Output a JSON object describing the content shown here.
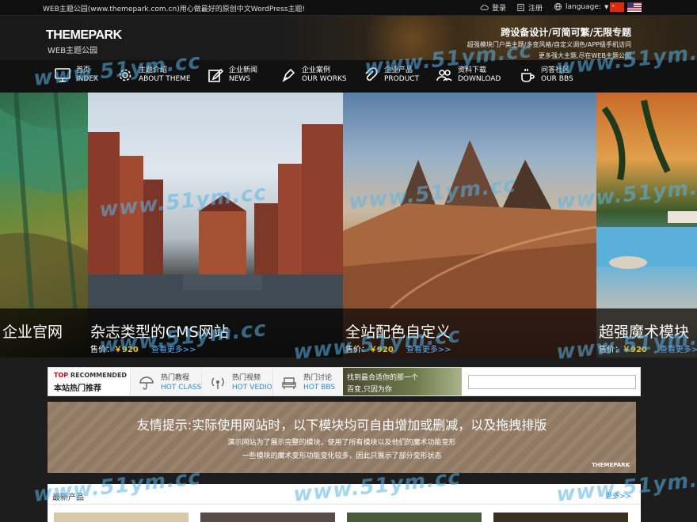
{
  "topbar": {
    "notice": "WEB主题公园(www.themepark.com.cn)用心做最好的原创中文WordPress主题!",
    "login": "登录",
    "register": "注册",
    "language": "language:"
  },
  "header": {
    "logo_main": "THEMEPARK",
    "logo_sub": "WEB主题公园",
    "slogan_1": "跨设备设计/可简可繁/无限专题",
    "slogan_2": "超强模块门户类主题/多变风格/自定义调色/APP级手机访问",
    "slogan_3": "更多强大主题,尽在WEB主题公园"
  },
  "nav": [
    {
      "cn": "首页",
      "en": "INDEX",
      "icon": "monitor-icon"
    },
    {
      "cn": "主题介绍",
      "en": "ABOUT THEME",
      "icon": "gear-icon"
    },
    {
      "cn": "企业新闻",
      "en": "NEWS",
      "icon": "pencil-icon"
    },
    {
      "cn": "企业案例",
      "en": "OUR WORKS",
      "icon": "pen-nib-icon"
    },
    {
      "cn": "企业产品",
      "en": "PRODUCT",
      "icon": "paperclip-icon"
    },
    {
      "cn": "资料下载",
      "en": "DOWNLOAD",
      "icon": "users-icon"
    },
    {
      "cn": "问答社区",
      "en": "OUR BBS",
      "icon": "coffee-icon"
    }
  ],
  "slides": [
    {
      "title": "企业官网",
      "price_label": "",
      "price": "",
      "more": ""
    },
    {
      "title": "杂志类型的CMS网站",
      "price_label": "售价：",
      "price": "￥920",
      "more": "查看更多>>"
    },
    {
      "title": "全站配色自定义",
      "price_label": "售价：",
      "price": "￥920",
      "more": "查看更多>>"
    },
    {
      "title": "超强魔术模块",
      "price_label": "售价：",
      "price": "￥920",
      "more": "查看更多>>"
    }
  ],
  "tabs": {
    "top_word": "TOP",
    "recommended_word": "RECOMMENDED",
    "recommended_cn": "本站热门推荐",
    "items": [
      {
        "cn": "热门教程",
        "en": "HOT CLASS",
        "icon": "umbrella-icon"
      },
      {
        "cn": "热门视频",
        "en": "HOT VEDIO",
        "icon": "broadcast-icon"
      },
      {
        "cn": "热门讨论",
        "en": "HOT BBS",
        "icon": "sofa-icon"
      }
    ],
    "ad_line1": "找到最合适你的那一个",
    "ad_line2": "百变,只因为你"
  },
  "banner": {
    "title": "友情提示:实际使用网站时，以下模块均可自由增加或删减，以及拖拽排版",
    "line1": "演示网站为了展示完整的模块，使用了所有模块以及他们的魔术功能变形",
    "line2": "一些模块的魔术变形功能变化较多，因此只展示了部分变形状态",
    "brand": "THEMEPARK"
  },
  "latest": {
    "title": "最新产品",
    "more": "更多>>"
  },
  "watermark": "www.51ym.cc",
  "colors": {
    "price": "#f2c21b",
    "link": "#5ab0ff",
    "accent_red": "#d0021b"
  }
}
